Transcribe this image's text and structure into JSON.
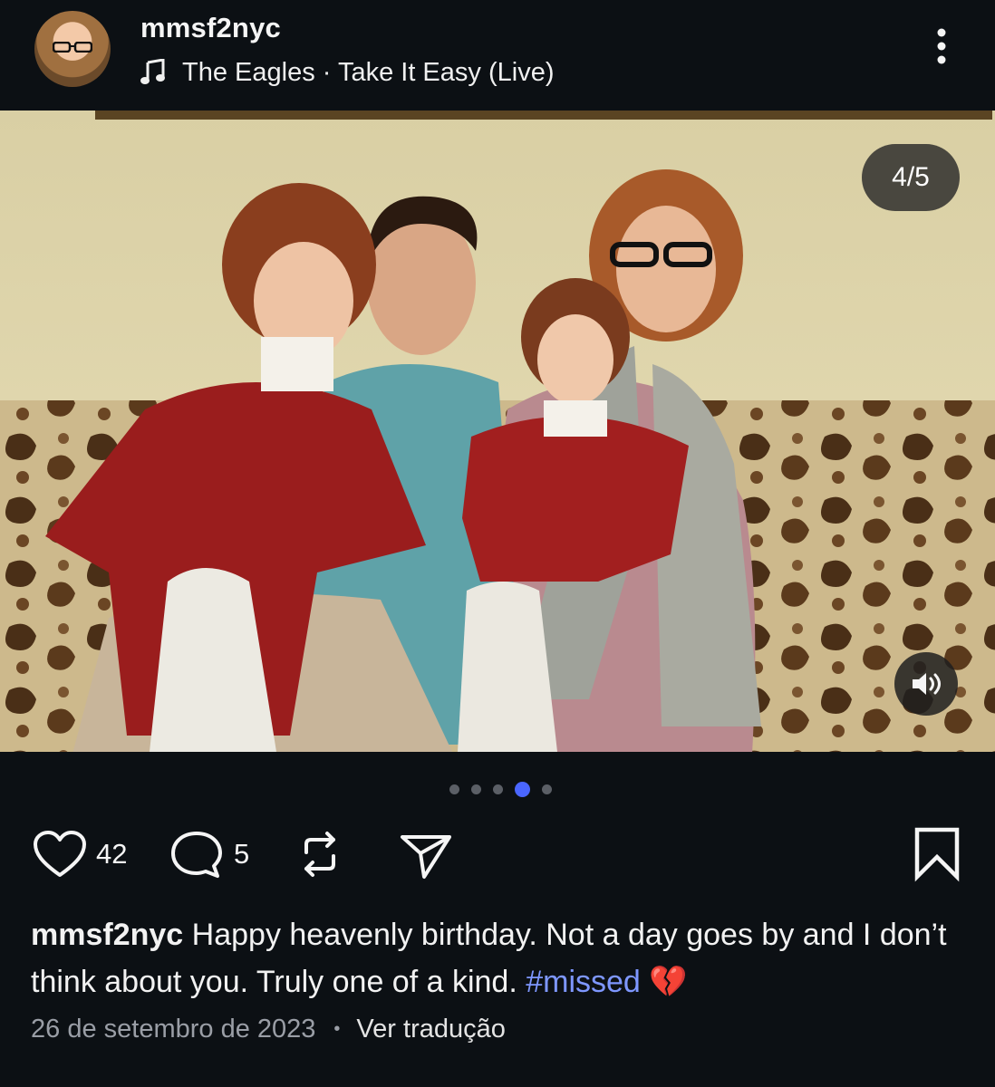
{
  "post": {
    "username": "mmsf2nyc",
    "music": "The Eagles · Take It Easy (Live)",
    "slide_counter": "4/5",
    "slide_index": 4,
    "slide_total": 5,
    "likes": "42",
    "comments": "5",
    "caption": {
      "username": "mmsf2nyc",
      "text": "Happy heavenly birthday.  Not a day goes by and I don’t think about you. Truly one of a kind.",
      "hashtag": "#missed",
      "emoji": "💔"
    },
    "date": "26 de setembro de 2023",
    "separator": "•",
    "translate_label": "Ver tradução"
  },
  "icons": {
    "music": "music-note-icon",
    "more": "more-vertical-icon",
    "sound": "speaker-icon",
    "like": "heart-icon",
    "comment": "comment-icon",
    "repost": "repost-icon",
    "share": "send-icon",
    "save": "bookmark-icon"
  },
  "colors": {
    "background": "#0c1014",
    "hashtag": "#7e97ff",
    "active_dot": "#4a66ff",
    "inactive_dot": "#5b5f66"
  }
}
